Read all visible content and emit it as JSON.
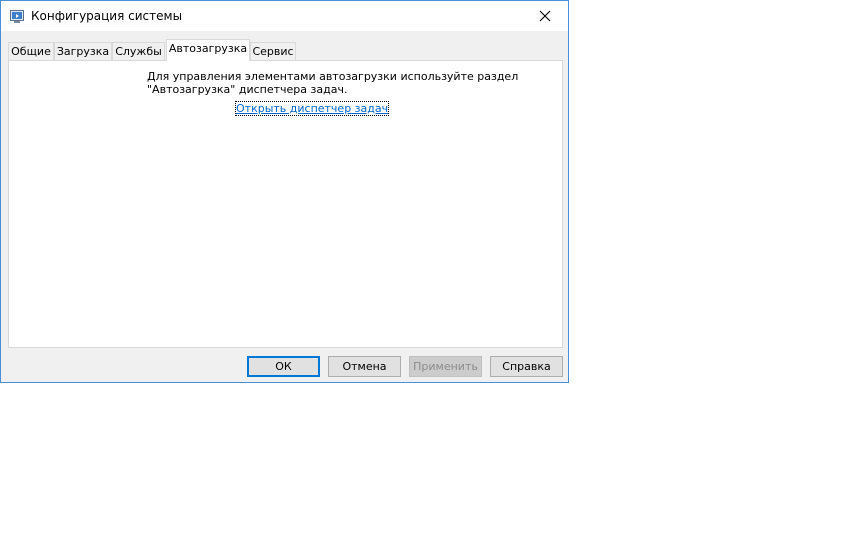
{
  "window": {
    "title": "Конфигурация системы",
    "icon": "msconfig-icon"
  },
  "tabs": [
    {
      "label": "Общие",
      "active": false
    },
    {
      "label": "Загрузка",
      "active": false
    },
    {
      "label": "Службы",
      "active": false
    },
    {
      "label": "Автозагрузка",
      "active": true
    },
    {
      "label": "Сервис",
      "active": false
    }
  ],
  "startup": {
    "info_line1": "Для управления элементами автозагрузки используйте раздел",
    "info_line2": "\"Автозагрузка\" диспетчера задач.",
    "link_label": "Открыть диспетчер задач"
  },
  "buttons": {
    "ok": "ОК",
    "cancel": "Отмена",
    "apply": "Применить",
    "help": "Справка"
  },
  "colors": {
    "accent": "#0078d7",
    "link": "#0066cc",
    "window_border": "#4a90d9"
  }
}
